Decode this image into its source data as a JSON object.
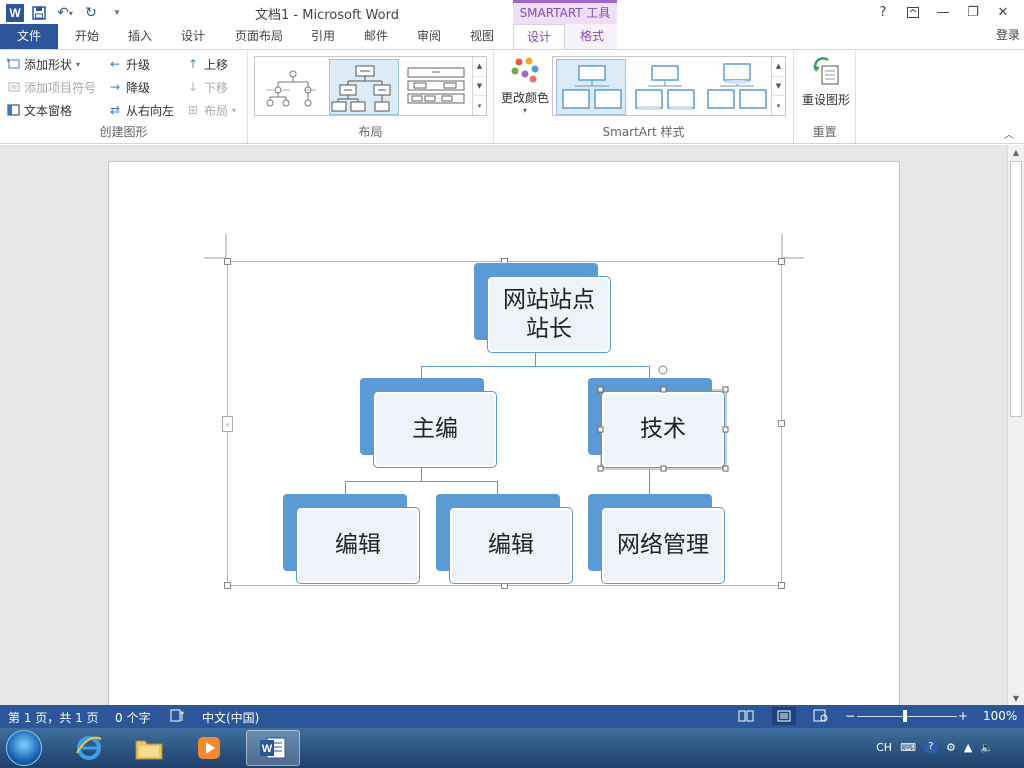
{
  "titlebar": {
    "doc_title": "文档1 - Microsoft Word",
    "context_header": "SMARTART 工具",
    "help": "?",
    "minimize": "—",
    "restore": "❐",
    "close": "✕"
  },
  "tabs": {
    "file": "文件",
    "home": "开始",
    "insert": "插入",
    "design": "设计",
    "page_layout": "页面布局",
    "references": "引用",
    "mailings": "邮件",
    "review": "审阅",
    "view": "视图",
    "sa_design": "设计",
    "sa_format": "格式",
    "login": "登录"
  },
  "ribbon": {
    "create_graphic": {
      "label": "创建图形",
      "add_shape": "添加形状",
      "add_bullet": "添加项目符号",
      "text_pane": "文本窗格",
      "promote": "升级",
      "demote": "降级",
      "right_to_left": "从右向左",
      "move_up": "上移",
      "move_down": "下移",
      "layout": "布局"
    },
    "layouts": {
      "label": "布局"
    },
    "styles": {
      "label": "SmartArt 样式",
      "change_colors": "更改颜色"
    },
    "reset": {
      "label": "重置",
      "reset_graphic": "重设图形"
    }
  },
  "smartart": {
    "root": "网站站点站长",
    "root_line1": "网站站点",
    "root_line2": "站长",
    "child1": "主编",
    "child2": "技术",
    "leaf1": "编辑",
    "leaf2": "编辑",
    "leaf3": "网络管理"
  },
  "statusbar": {
    "page": "第 1 页，共 1 页",
    "words": "0 个字",
    "language": "中文(中国)",
    "zoom": "100%"
  },
  "tray": {
    "ime": "CH"
  },
  "colors": {
    "word_blue": "#2b579a",
    "smartart_accent": "#5b9bd5",
    "context_purple": "#8a4cb7"
  }
}
